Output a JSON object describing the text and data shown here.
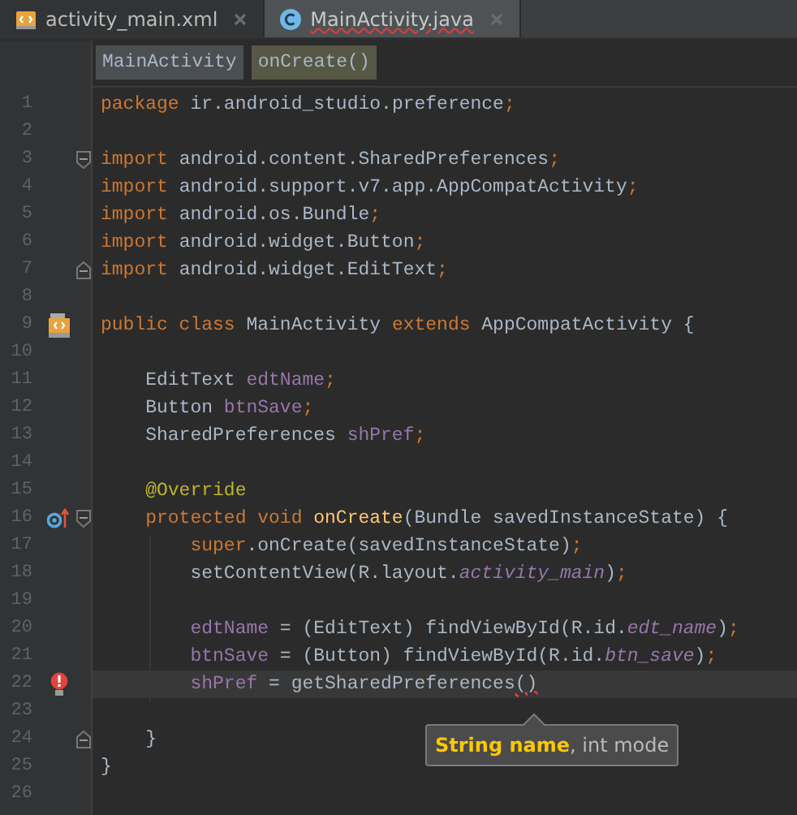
{
  "tabs": [
    {
      "label": "activity_main.xml",
      "kind": "layout",
      "selected": false,
      "error": false
    },
    {
      "label": "MainActivity.java",
      "kind": "class",
      "selected": true,
      "error": true
    }
  ],
  "breadcrumbs": [
    {
      "label": "MainActivity",
      "kind": "class"
    },
    {
      "label": "onCreate()",
      "kind": "method"
    }
  ],
  "lines": [
    {
      "number": "1",
      "tokens": [
        {
          "text": "package ",
          "kind": "keyword"
        },
        {
          "text": "ir.android_studio.preference",
          "kind": "plain"
        },
        {
          "text": ";",
          "kind": "keyword"
        }
      ]
    },
    {
      "number": "2"
    },
    {
      "number": "3",
      "tokens": [
        {
          "text": "import ",
          "kind": "keyword"
        },
        {
          "text": "android.content.SharedPreferences",
          "kind": "plain"
        },
        {
          "text": ";",
          "kind": "keyword"
        }
      ]
    },
    {
      "number": "4",
      "tokens": [
        {
          "text": "import ",
          "kind": "keyword"
        },
        {
          "text": "android.support.v7.app.AppCompatActivity",
          "kind": "plain"
        },
        {
          "text": ";",
          "kind": "keyword"
        }
      ]
    },
    {
      "number": "5",
      "tokens": [
        {
          "text": "import ",
          "kind": "keyword"
        },
        {
          "text": "android.os.Bundle",
          "kind": "plain"
        },
        {
          "text": ";",
          "kind": "keyword"
        }
      ]
    },
    {
      "number": "6",
      "tokens": [
        {
          "text": "import ",
          "kind": "keyword"
        },
        {
          "text": "android.widget.Button",
          "kind": "plain"
        },
        {
          "text": ";",
          "kind": "keyword"
        }
      ]
    },
    {
      "number": "7",
      "tokens": [
        {
          "text": "import ",
          "kind": "keyword"
        },
        {
          "text": "android.widget.EditText",
          "kind": "plain"
        },
        {
          "text": ";",
          "kind": "keyword"
        }
      ]
    },
    {
      "number": "8"
    },
    {
      "number": "9",
      "tokens": [
        {
          "text": "public class ",
          "kind": "keyword"
        },
        {
          "text": "MainActivity ",
          "kind": "plain"
        },
        {
          "text": "extends ",
          "kind": "keyword"
        },
        {
          "text": "AppCompatActivity {",
          "kind": "plain"
        }
      ]
    },
    {
      "number": "10"
    },
    {
      "number": "11",
      "tokens": [
        {
          "text": "    EditText ",
          "kind": "plain"
        },
        {
          "text": "edtName",
          "kind": "field"
        },
        {
          "text": ";",
          "kind": "keyword"
        }
      ]
    },
    {
      "number": "12",
      "tokens": [
        {
          "text": "    Button ",
          "kind": "plain"
        },
        {
          "text": "btnSave",
          "kind": "field"
        },
        {
          "text": ";",
          "kind": "keyword"
        }
      ]
    },
    {
      "number": "13",
      "tokens": [
        {
          "text": "    SharedPreferences ",
          "kind": "plain"
        },
        {
          "text": "shPref",
          "kind": "field"
        },
        {
          "text": ";",
          "kind": "keyword"
        }
      ]
    },
    {
      "number": "14"
    },
    {
      "number": "15",
      "tokens": [
        {
          "text": "    @Override",
          "kind": "annotation"
        }
      ]
    },
    {
      "number": "16",
      "tokens": [
        {
          "text": "    protected void ",
          "kind": "keyword"
        },
        {
          "text": "onCreate",
          "kind": "method"
        },
        {
          "text": "(Bundle savedInstanceState) {",
          "kind": "plain"
        }
      ]
    },
    {
      "number": "17",
      "tokens": [
        {
          "text": "        super",
          "kind": "keyword"
        },
        {
          "text": ".onCreate(savedInstanceState)",
          "kind": "plain"
        },
        {
          "text": ";",
          "kind": "keyword"
        }
      ]
    },
    {
      "number": "18",
      "tokens": [
        {
          "text": "        setContentView(R.layout.",
          "kind": "plain"
        },
        {
          "text": "activity_main",
          "kind": "static"
        },
        {
          "text": ")",
          "kind": "plain"
        },
        {
          "text": ";",
          "kind": "keyword"
        }
      ]
    },
    {
      "number": "19"
    },
    {
      "number": "20",
      "tokens": [
        {
          "text": "        edtName",
          "kind": "field"
        },
        {
          "text": " = (EditText) findViewById(R.id.",
          "kind": "plain"
        },
        {
          "text": "edt_name",
          "kind": "static"
        },
        {
          "text": ")",
          "kind": "plain"
        },
        {
          "text": ";",
          "kind": "keyword"
        }
      ]
    },
    {
      "number": "21",
      "tokens": [
        {
          "text": "        btnSave",
          "kind": "field"
        },
        {
          "text": " = (Button) findViewById(R.id.",
          "kind": "plain"
        },
        {
          "text": "btn_save",
          "kind": "static"
        },
        {
          "text": ")",
          "kind": "plain"
        },
        {
          "text": ";",
          "kind": "keyword"
        }
      ]
    },
    {
      "number": "22",
      "current": true,
      "tokens": [
        {
          "text": "        shPref",
          "kind": "field"
        },
        {
          "text": " = getSharedPreferences",
          "kind": "plain"
        },
        {
          "text": "()",
          "kind": "error"
        }
      ]
    },
    {
      "number": "23"
    },
    {
      "number": "24",
      "tokens": [
        {
          "text": "    }",
          "kind": "plain"
        }
      ]
    },
    {
      "number": "25",
      "tokens": [
        {
          "text": "}",
          "kind": "plain"
        }
      ]
    },
    {
      "number": "26"
    }
  ],
  "tooltip": {
    "text": "**String name**, int mode"
  }
}
